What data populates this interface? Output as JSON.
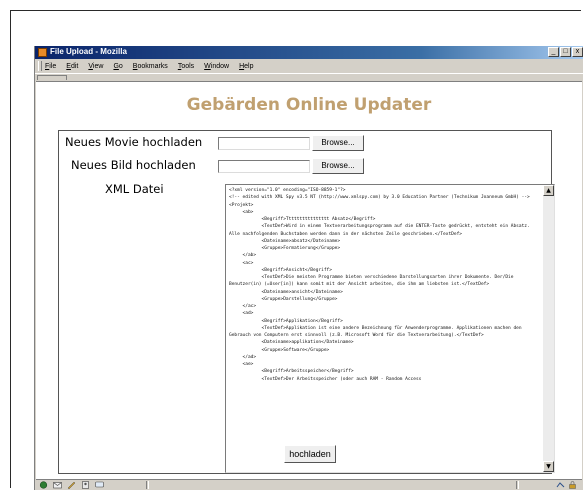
{
  "window": {
    "title": "File Upload - Mozilla",
    "controls": {
      "minimize": "_",
      "maximize": "□",
      "close": "x"
    }
  },
  "menu": [
    {
      "label": "File",
      "mnemonic": "F",
      "rest": "ile"
    },
    {
      "label": "Edit",
      "mnemonic": "E",
      "rest": "dit"
    },
    {
      "label": "View",
      "mnemonic": "V",
      "rest": "iew"
    },
    {
      "label": "Go",
      "mnemonic": "G",
      "rest": "o"
    },
    {
      "label": "Bookmarks",
      "mnemonic": "B",
      "rest": "ookmarks"
    },
    {
      "label": "Tools",
      "mnemonic": "T",
      "rest": "ools"
    },
    {
      "label": "Window",
      "mnemonic": "W",
      "rest": "indow"
    },
    {
      "label": "Help",
      "mnemonic": "H",
      "rest": "elp"
    }
  ],
  "page": {
    "heading": "Gebärden Online Updater",
    "heading_color": "#c0a070",
    "movie": {
      "label": "Neues Movie hochladen",
      "value": "",
      "button": "Browse..."
    },
    "image": {
      "label": "Neues Bild hochladen",
      "value": "",
      "button": "Browse..."
    },
    "xml": {
      "label": "XML Datei",
      "content": "<?xml version=\"1.0\" encoding=\"ISO-8859-1\"?>\n<!-- edited with XML Spy v3.5 NT (http://www.xmlspy.com) by 3.0 Education Partner (Technikum Joanneum GmbH) -->\n<Projekt>\n     <ab>\n            <Begriff>Tttttttttttttttt Absatz</Begriff>\n            <TextDef>Wird in einem Textverarbeitungsprogramm auf die ENTER-Taste gedrückt, entsteht ein Absatz. Alle nachfolgenden Buchstaben werden dann in der nächsten Zeile geschrieben.</TextDef>\n            <Dateiname>absatz</Dateiname>\n            <Gruppe>Formatierung</Gruppe>\n     </ab>\n     <ac>\n            <Begriff>Ansicht</Begriff>\n            <TextDef>Die meisten Programme bieten verschiedene Darstellungsarten ihrer Dokumente. Der/Die  Benutzer(in) (=User[in]) kann somit mit der Ansicht arbeiten, die ihm am liebsten ist.</TextDef>\n            <Dateiname>ansicht</Dateiname>\n            <Gruppe>Darstellung</Gruppe>\n     </ac>\n     <ad>\n            <Begriff>Applikation</Begriff>\n            <TextDef>Applikation ist eine andere Bezeichnung für Anwenderprogramme. Applikationen machen den Gebrauch von Computern erst sinnvoll (z.B. Microsoft Word für die Textverarbeitung).</TextDef>\n            <Dateiname>applikation</Dateiname>\n            <Gruppe>Software</Gruppe>\n     </ad>\n     <ae>\n            <Begriff>Arbeitsspeicher</Begriff>\n            <TextDef>Der Arbeitsspeicher (oder auch RAM - Random Access"
    },
    "submit": "hochladen"
  },
  "statusbar": {
    "icons": [
      "navigator-icon",
      "mail-icon",
      "composer-icon",
      "addressbook-icon",
      "irc-icon"
    ],
    "right_icons": [
      "online-icon",
      "security-icon"
    ]
  }
}
